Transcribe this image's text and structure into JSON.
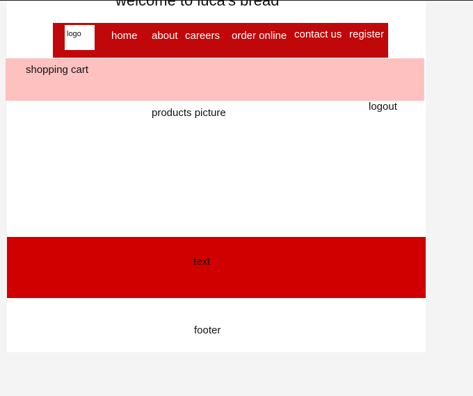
{
  "header": {
    "title": "welcome to luca's bread"
  },
  "nav": {
    "logo": "logo",
    "items": [
      {
        "label": "home"
      },
      {
        "label": "about"
      },
      {
        "label": "careers"
      },
      {
        "label": "order online"
      },
      {
        "label": "contact us"
      },
      {
        "label": "register"
      }
    ]
  },
  "subbar": {
    "cart": "shopping cart",
    "logout": "logout"
  },
  "main": {
    "products": "products picture",
    "text": "text"
  },
  "footer": {
    "label": "footer"
  },
  "colors": {
    "nav_bg": "#c0080a",
    "pink_band": "#ffc0c0",
    "text_band": "#d10000",
    "background": "#f4f4f4"
  }
}
